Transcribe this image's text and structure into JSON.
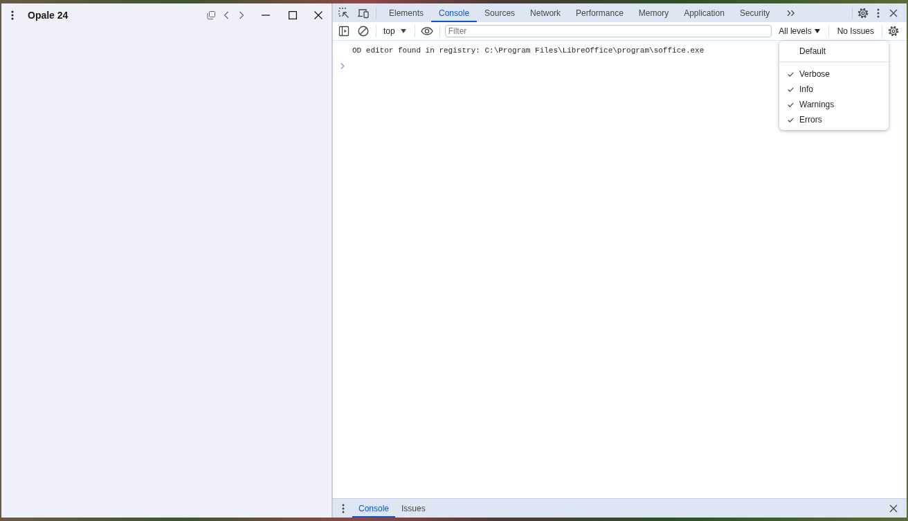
{
  "app_window": {
    "title": "Opale 24"
  },
  "devtools": {
    "tabs": [
      {
        "label": "Elements",
        "selected": false
      },
      {
        "label": "Console",
        "selected": true
      },
      {
        "label": "Sources",
        "selected": false
      },
      {
        "label": "Network",
        "selected": false
      },
      {
        "label": "Performance",
        "selected": false
      },
      {
        "label": "Memory",
        "selected": false
      },
      {
        "label": "Application",
        "selected": false
      },
      {
        "label": "Security",
        "selected": false
      }
    ]
  },
  "toolbar": {
    "context": "top",
    "filter": {
      "placeholder": "Filter"
    },
    "levels_button": "All levels",
    "issues_button": "No Issues"
  },
  "console": {
    "messages": [
      "OD editor found in registry: C:\\Program Files\\LibreOffice\\program\\soffice.exe"
    ]
  },
  "levels_menu": {
    "items": [
      {
        "kind": "preset",
        "label": "Default",
        "checked": false
      },
      {
        "kind": "level",
        "label": "Verbose",
        "checked": true
      },
      {
        "kind": "level",
        "label": "Info",
        "checked": true
      },
      {
        "kind": "level",
        "label": "Warnings",
        "checked": true
      },
      {
        "kind": "level",
        "label": "Errors",
        "checked": true
      }
    ]
  },
  "drawer": {
    "tabs": [
      {
        "label": "Console",
        "selected": true
      },
      {
        "label": "Issues",
        "selected": false
      }
    ]
  }
}
